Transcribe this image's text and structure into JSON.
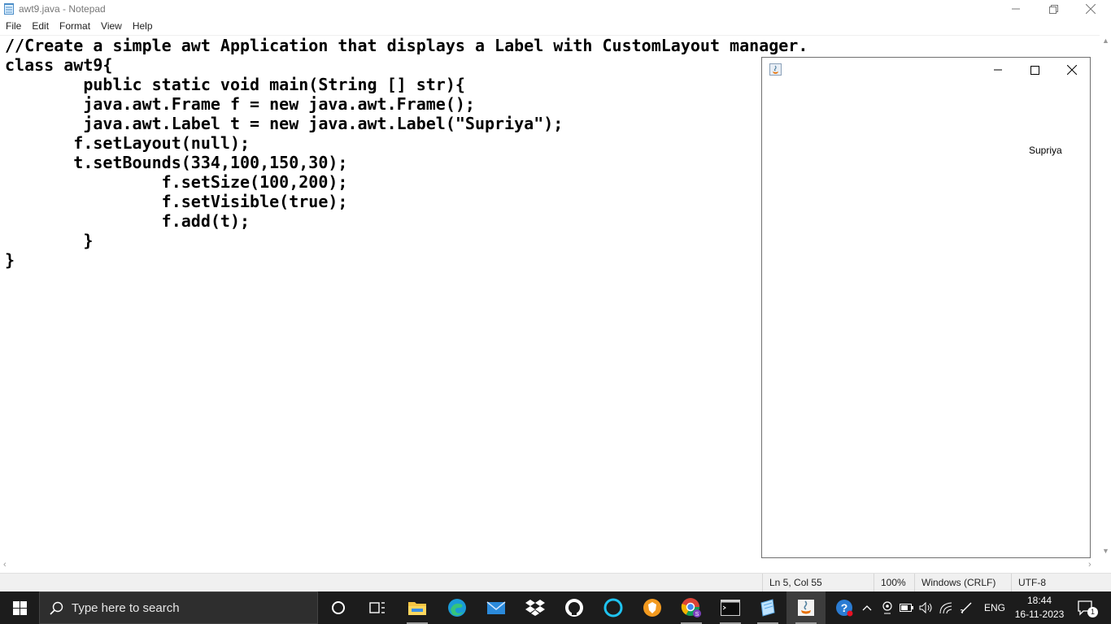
{
  "window": {
    "title": "awt9.java - Notepad"
  },
  "menu": [
    "File",
    "Edit",
    "Format",
    "View",
    "Help"
  ],
  "editor": {
    "lines": [
      "//Create a simple awt Application that displays a Label with CustomLayout manager.",
      "class awt9{",
      "        public static void main(String [] str){",
      "        java.awt.Frame f = new java.awt.Frame();",
      "        java.awt.Label t = new java.awt.Label(\"Supriya\");",
      "       f.setLayout(null);",
      "       t.setBounds(334,100,150,30);",
      "                f.setSize(100,200);",
      "                f.setVisible(true);",
      "                f.add(t);",
      "        }",
      "}"
    ]
  },
  "status": {
    "position": "Ln 5, Col 55",
    "zoom": "100%",
    "line_ending": "Windows (CRLF)",
    "encoding": "UTF-8"
  },
  "awt_frame": {
    "label": "Supriya"
  },
  "taskbar": {
    "search_placeholder": "Type here to search",
    "pinned_icons": [
      "cortana-icon",
      "task-view-icon",
      "file-explorer-icon",
      "edge-icon",
      "mail-icon",
      "dropbox-icon",
      "github-icon",
      "alexa-icon",
      "brave-icon",
      "chrome-icon",
      "command-prompt-icon",
      "notepad-icon",
      "java-icon"
    ],
    "language": "ENG",
    "time": "18:44",
    "date": "16-11-2023",
    "notifications": "1"
  },
  "colors": {
    "taskbar_bg": "#1c1c1c",
    "statusbar_bg": "#f0f0f0",
    "accent": "#0078d7"
  }
}
